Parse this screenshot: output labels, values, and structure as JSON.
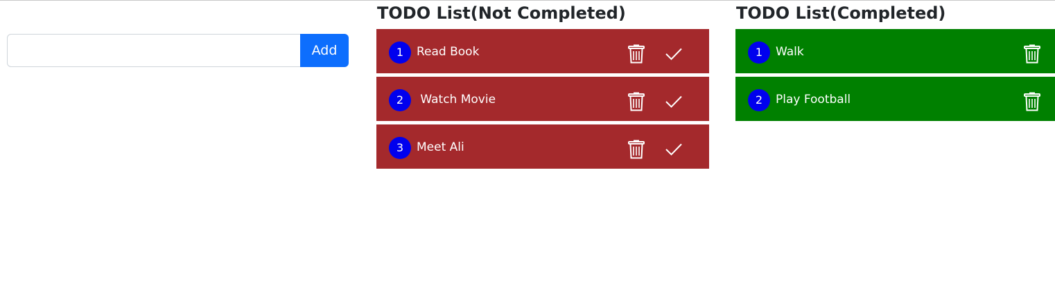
{
  "add_form": {
    "input_value": "",
    "input_placeholder": "",
    "button_label": "Add"
  },
  "not_completed": {
    "title": "TODO List(Not Completed)",
    "item_color": "#a4292c",
    "items": [
      {
        "number": "1",
        "text": "Read Book"
      },
      {
        "number": "2",
        "text": " Watch Movie"
      },
      {
        "number": "3",
        "text": "Meet Ali"
      }
    ]
  },
  "completed": {
    "title": "TODO List(Completed)",
    "item_color": "#008000",
    "items": [
      {
        "number": "1",
        "text": "Walk"
      },
      {
        "number": "2",
        "text": "Play Football"
      }
    ]
  },
  "colors": {
    "add_button": "#0d6efd",
    "number_badge": "#0000ee"
  },
  "icons": {
    "delete": "trash-icon",
    "complete": "check-icon"
  }
}
